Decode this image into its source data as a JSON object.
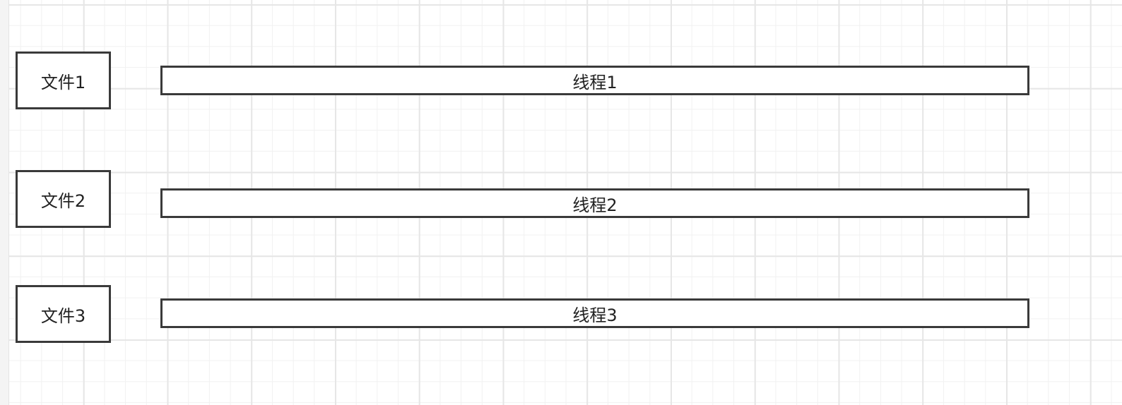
{
  "diagram": {
    "files": [
      {
        "label": "文件1"
      },
      {
        "label": "文件2"
      },
      {
        "label": "文件3"
      }
    ],
    "threads": [
      {
        "label": "线程1"
      },
      {
        "label": "线程2"
      },
      {
        "label": "线程3"
      }
    ]
  }
}
